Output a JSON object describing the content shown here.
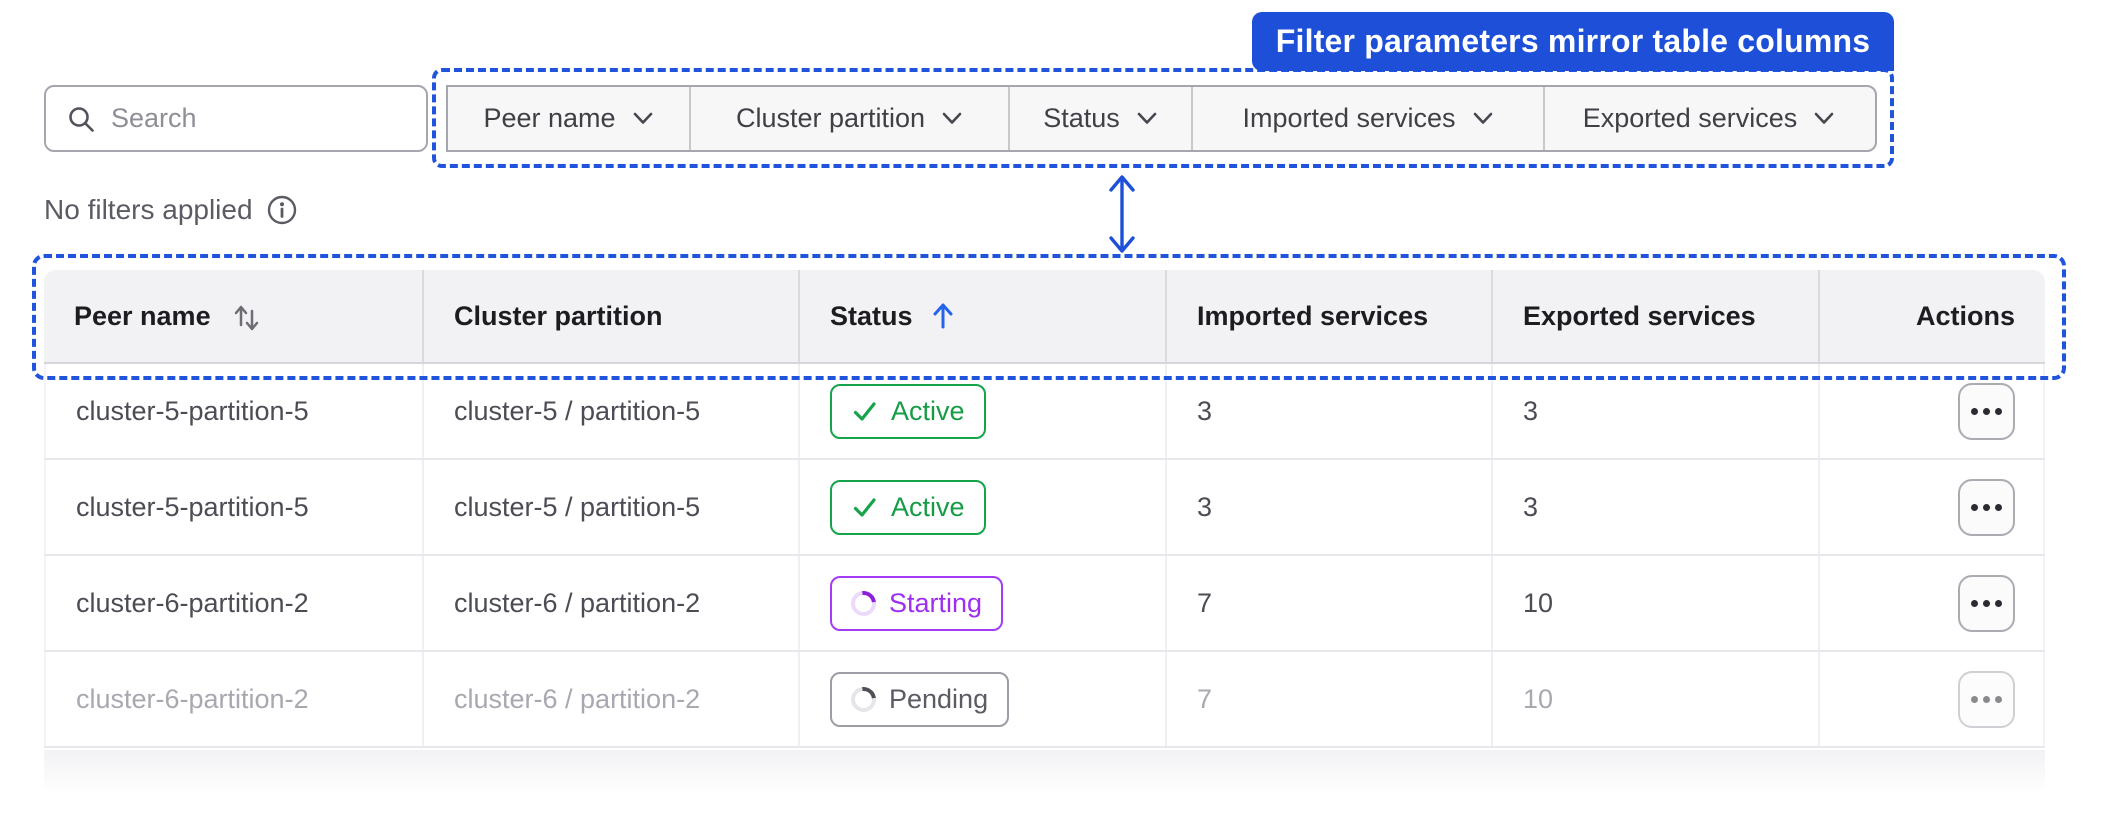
{
  "callout": {
    "label": "Filter parameters mirror table columns"
  },
  "filter_bar": {
    "search_placeholder": "Search",
    "filters": [
      "Peer name",
      "Cluster partition",
      "Status",
      "Imported services",
      "Exported services"
    ],
    "status_text": "No filters applied"
  },
  "table": {
    "columns": [
      "Peer name",
      "Cluster partition",
      "Status",
      "Imported services",
      "Exported services",
      "Actions"
    ],
    "sort": {
      "column": "Status",
      "direction": "ascending",
      "peer_name_icon": "sort-both-icon",
      "status_icon": "sort-ascending-icon"
    },
    "rows": [
      {
        "peer_name": "cluster-5-partition-5",
        "cluster_partition": "cluster-5 / partition-5",
        "status": "Active",
        "imported": "3",
        "exported": "3",
        "muted": false
      },
      {
        "peer_name": "cluster-5-partition-5",
        "cluster_partition": "cluster-5 / partition-5",
        "status": "Active",
        "imported": "3",
        "exported": "3",
        "muted": false
      },
      {
        "peer_name": "cluster-6-partition-2",
        "cluster_partition": "cluster-6 / partition-2",
        "status": "Starting",
        "imported": "7",
        "exported": "10",
        "muted": false
      },
      {
        "peer_name": "cluster-6-partition-2",
        "cluster_partition": "cluster-6 / partition-2",
        "status": "Pending",
        "imported": "7",
        "exported": "10",
        "muted": true
      }
    ]
  },
  "colors": {
    "annotation_blue": "#1d4fd8",
    "active_green": "#16a34a",
    "starting_purple": "#9d2ff0",
    "pending_gray": "#5b5b63"
  }
}
